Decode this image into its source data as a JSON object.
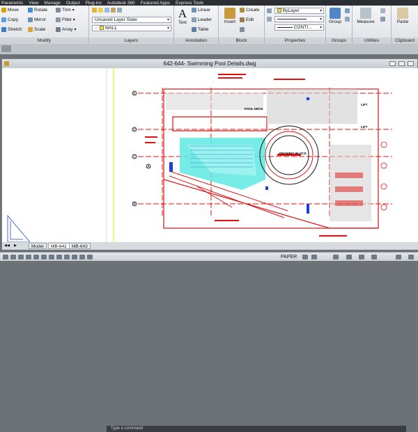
{
  "ribbon_tabs": [
    "Parametric",
    "View",
    "Manage",
    "Output",
    "Plug-ins",
    "Autodesk 360",
    "Featured Apps",
    "Express Tools"
  ],
  "modify": {
    "title": "Modify",
    "items": [
      {
        "label": "Move",
        "icon": "move-icon"
      },
      {
        "label": "Rotate",
        "icon": "rotate-icon"
      },
      {
        "label": "Trim",
        "icon": "trim-icon"
      },
      {
        "label": "Copy",
        "icon": "copy-icon"
      },
      {
        "label": "Mirror",
        "icon": "mirror-icon"
      },
      {
        "label": "Fillet",
        "icon": "fillet-icon"
      },
      {
        "label": "Stretch",
        "icon": "stretch-icon"
      },
      {
        "label": "Scale",
        "icon": "scale-icon"
      },
      {
        "label": "Array",
        "icon": "array-icon"
      }
    ]
  },
  "layers": {
    "title": "Layers",
    "layer_state": "Unsaved Layer State",
    "current_layer": "WALL"
  },
  "annotation": {
    "title": "Annotation",
    "text_label": "Text",
    "linear_label": "Linear",
    "leader_label": "Leader",
    "table_label": "Table"
  },
  "block": {
    "title": "Block",
    "insert_label": "Insert",
    "create_label": "Create",
    "edit_label": "Edit"
  },
  "properties": {
    "title": "Properties",
    "color": "ByLayer",
    "linetype": "ByLayer",
    "lineweight": "CONTI..."
  },
  "groups": {
    "title": "Groups",
    "group_label": "Group"
  },
  "utilities": {
    "title": "Utilities",
    "measure_label": "Measure"
  },
  "clipboard": {
    "title": "Clipboard",
    "paste_label": "Paste"
  },
  "drawing": {
    "title": "642-644- Swimming Pool Details.dwg",
    "room_labels": [
      "LIFT",
      "LIFT",
      "POOL DECK",
      "DRAWING BLOCK"
    ],
    "axis_labels": [
      "E",
      "D",
      "C",
      "B",
      "A"
    ]
  },
  "layout_tabs": [
    "Model",
    "MB-642",
    "MB-643"
  ],
  "command_line": "Type a command",
  "status": {
    "space": "PAPER"
  },
  "colors": {
    "accent_blue": "#2f76c9",
    "drawing_red": "#e01010",
    "pool_cyan": "#5fe8e0",
    "layer_yellow": "#f2e600"
  }
}
